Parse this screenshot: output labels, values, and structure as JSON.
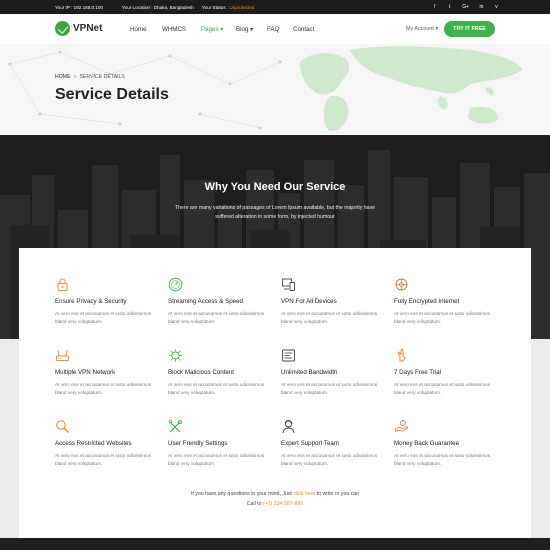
{
  "topbar": {
    "ip_label": "Your IP : 192.168.0.100",
    "location_label": "Your Location : Dhaka, Bangladesh",
    "status_prefix": "Your Status : ",
    "status_value": "Unprotected",
    "social": [
      "f",
      "t",
      "G+",
      "in",
      "v"
    ]
  },
  "nav": {
    "logo": "VPNet",
    "items": [
      "Home",
      "WHMCS",
      "Pages",
      "Blog",
      "FAQ",
      "Contact"
    ],
    "caret": "▾",
    "account": "My Account ▾",
    "cta": "TRY IT FREE"
  },
  "hero": {
    "crumb_home": "HOME",
    "crumb_sep": "»",
    "crumb_current": "SERVICE DETAILS",
    "title": "Service Details"
  },
  "band": {
    "title": "Why You Need Our Service",
    "text": "There are many variations of passages of Lorem Ipsum available, but the majority have suffered alteration in some form, by injected humour"
  },
  "features": [
    {
      "title": "Ensure Privacy & Security",
      "desc": "At vero eos et accusamus et iusto odioissimos bland very voluptatum.",
      "icon": "lock-icon"
    },
    {
      "title": "Streaming Access & Speed",
      "desc": "At vero eos et accusamus et iusto odioissimos bland very voluptatum.",
      "icon": "speedometer-icon"
    },
    {
      "title": "VPN For All Devices",
      "desc": "At vero eos et accusamus et iusto odioissimos bland very voluptatum.",
      "icon": "devices-icon"
    },
    {
      "title": "Fully Encrypted Internet",
      "desc": "At vero eos et accusamus et iusto odioissimos bland very voluptatum.",
      "icon": "encryption-icon"
    },
    {
      "title": "Multiple VPN Network",
      "desc": "At vero eos et accusamus et iusto odioissimos bland very voluptatum.",
      "icon": "router-icon"
    },
    {
      "title": "Block Malicious Content",
      "desc": "At vero eos et accusamus et iusto odioissimos bland very voluptatum.",
      "icon": "virus-icon"
    },
    {
      "title": "Unlimited Bandwidth",
      "desc": "At vero eos et accusamus et iusto odioissimos bland very voluptatum.",
      "icon": "bandwidth-icon"
    },
    {
      "title": "7 Days Free Trial",
      "desc": "At vero eos et accusamus et iusto odioissimos bland very voluptatum.",
      "icon": "hand-gift-icon"
    },
    {
      "title": "Access Restricted Websites",
      "desc": "At vero eos et accusamus et iusto odioissimos bland very voluptatum.",
      "icon": "search-icon"
    },
    {
      "title": "User Frendly Settings",
      "desc": "At vero eos et accusamus et iusto odioissimos bland very voluptatum.",
      "icon": "tools-icon"
    },
    {
      "title": "Expert Support Team",
      "desc": "At vero eos et accusamus et iusto odioissimos bland very voluptatum.",
      "icon": "support-icon"
    },
    {
      "title": "Money Back Guarantee",
      "desc": "At vero eos et accusamus et iusto odioissimos bland very voluptatum.",
      "icon": "money-back-icon"
    }
  ],
  "contact": {
    "line1_before": "If you have any questions in your mind, Just ",
    "line1_link": "click here",
    "line1_after": " to write or you can",
    "line2_before": "Call to ",
    "phone": "(+1) 234-567-890"
  },
  "colors": {
    "accent": "#3bb54a",
    "highlight": "#ff8a1d",
    "dark": "#1c1c1c"
  }
}
